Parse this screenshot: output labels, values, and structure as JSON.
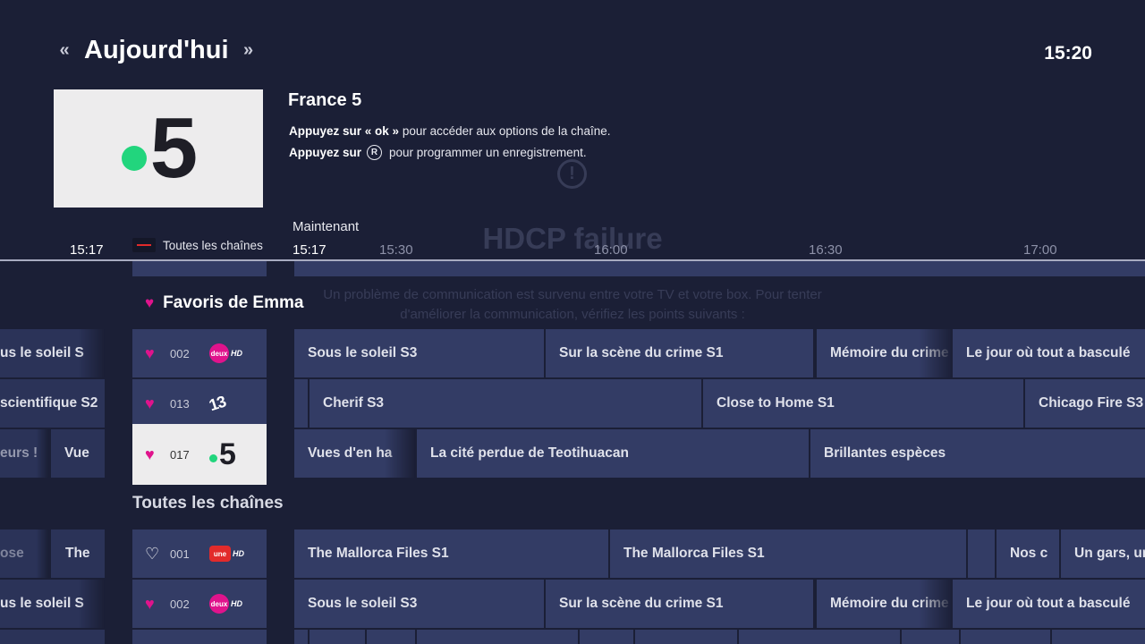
{
  "header": {
    "prev_icon": "double-chevron-left-icon",
    "title": "Aujourd'hui",
    "next_icon": "double-chevron-right-icon",
    "clock": "15:20"
  },
  "info": {
    "channel_name": "France 5",
    "logo_number": "5",
    "hint1_bold": "Appuyez sur « ok »",
    "hint1_rest": "pour accéder aux options de la chaîne.",
    "hint2_bold": "Appuyez sur",
    "hint2_icon_letter": "R",
    "hint2_rest": "pour programmer un enregistrement."
  },
  "overlay": {
    "icon": "!",
    "title": "HDCP failure",
    "line1": "Un problème de communication est survenu entre votre TV et votre box. Pour tenter",
    "line2": "d'améliorer la communication, vérifiez les points suivants :"
  },
  "timeline": {
    "now_label": "Maintenant",
    "current_time": "15:17",
    "filter_label": "Toutes les chaînes",
    "ticks": [
      "15:17",
      "15:30",
      "16:00",
      "16:30",
      "17:00"
    ]
  },
  "sections": {
    "favorites_title": "Favoris de Emma",
    "all_title": "Toutes les chaînes"
  },
  "rows": [
    {
      "number": "002",
      "logo": "france2-hd-logo",
      "favorite": true,
      "left": [
        "us le soleil S"
      ],
      "programs": [
        "Sous le soleil S3",
        "Sur la scène du crime S1",
        "Mémoire du crime S",
        "Le jour où tout a basculé"
      ]
    },
    {
      "number": "013",
      "logo": "13eme-rue-logo",
      "favorite": true,
      "left": [
        "scientifique S2"
      ],
      "programs": [
        "",
        "Cherif S3",
        "Close to Home S1",
        "Chicago Fire S3"
      ]
    },
    {
      "number": "017",
      "logo": "france5-logo",
      "favorite": true,
      "left": [
        "eurs !",
        "Vue"
      ],
      "programs": [
        "Vues d'en ha",
        "La cité perdue de Teotihuacan",
        "Brillantes espèces"
      ]
    },
    {
      "number": "001",
      "logo": "france1-hd-logo",
      "favorite": false,
      "left": [
        "ose",
        "The"
      ],
      "programs": [
        "The Mallorca Files S1",
        "The Mallorca Files S1",
        "",
        "Nos c",
        "Un gars, un"
      ]
    },
    {
      "number": "002",
      "logo": "france2-hd-logo",
      "favorite": true,
      "left": [
        "us le soleil S"
      ],
      "programs": [
        "Sous le soleil S3",
        "Sur la scène du crime S1",
        "Mémoire du crime S",
        "Le jour où tout a basculé"
      ]
    }
  ],
  "logos": {
    "deux": "deux",
    "hd": "HD",
    "une": "une",
    "treize": "13"
  },
  "colors": {
    "background": "#1b1f36",
    "tile": "#333c65",
    "favorite_heart": "#e0138c",
    "france5_dot": "#22d57d",
    "selected_tile": "#edeced"
  }
}
